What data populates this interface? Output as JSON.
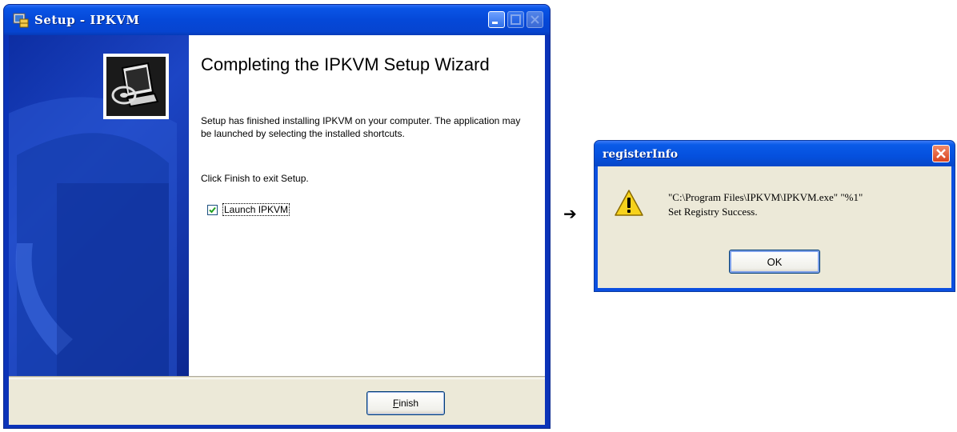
{
  "setup_window": {
    "title": "Setup - IPKVM",
    "heading": "Completing the IPKVM Setup Wizard",
    "body_text": "Setup has finished installing IPKVM on your computer. The application may be launched by selecting the installed shortcuts.",
    "exit_text": "Click Finish to exit Setup.",
    "launch_checkbox": {
      "label": "Launch IPKVM",
      "checked": true
    },
    "finish_button": {
      "mnemonic": "F",
      "rest": "inish"
    },
    "icons": [
      "setup-app-icon",
      "computer-cd-icon",
      "minimize-icon",
      "maximize-icon",
      "close-icon"
    ]
  },
  "arrow": "➔",
  "register_dialog": {
    "title": "registerInfo",
    "message_line1": "\"C:\\Program Files\\IPKVM\\IPKVM.exe\" \"%1\"",
    "message_line2": "Set Registry Success.",
    "ok_label": "OK",
    "icons": [
      "warning-icon",
      "close-icon"
    ]
  },
  "colors": {
    "titlebar_blue": "#0548d8",
    "banner_blue": "#1c45c5",
    "dialog_face": "#ece9d8",
    "close_red": "#d9451f"
  }
}
